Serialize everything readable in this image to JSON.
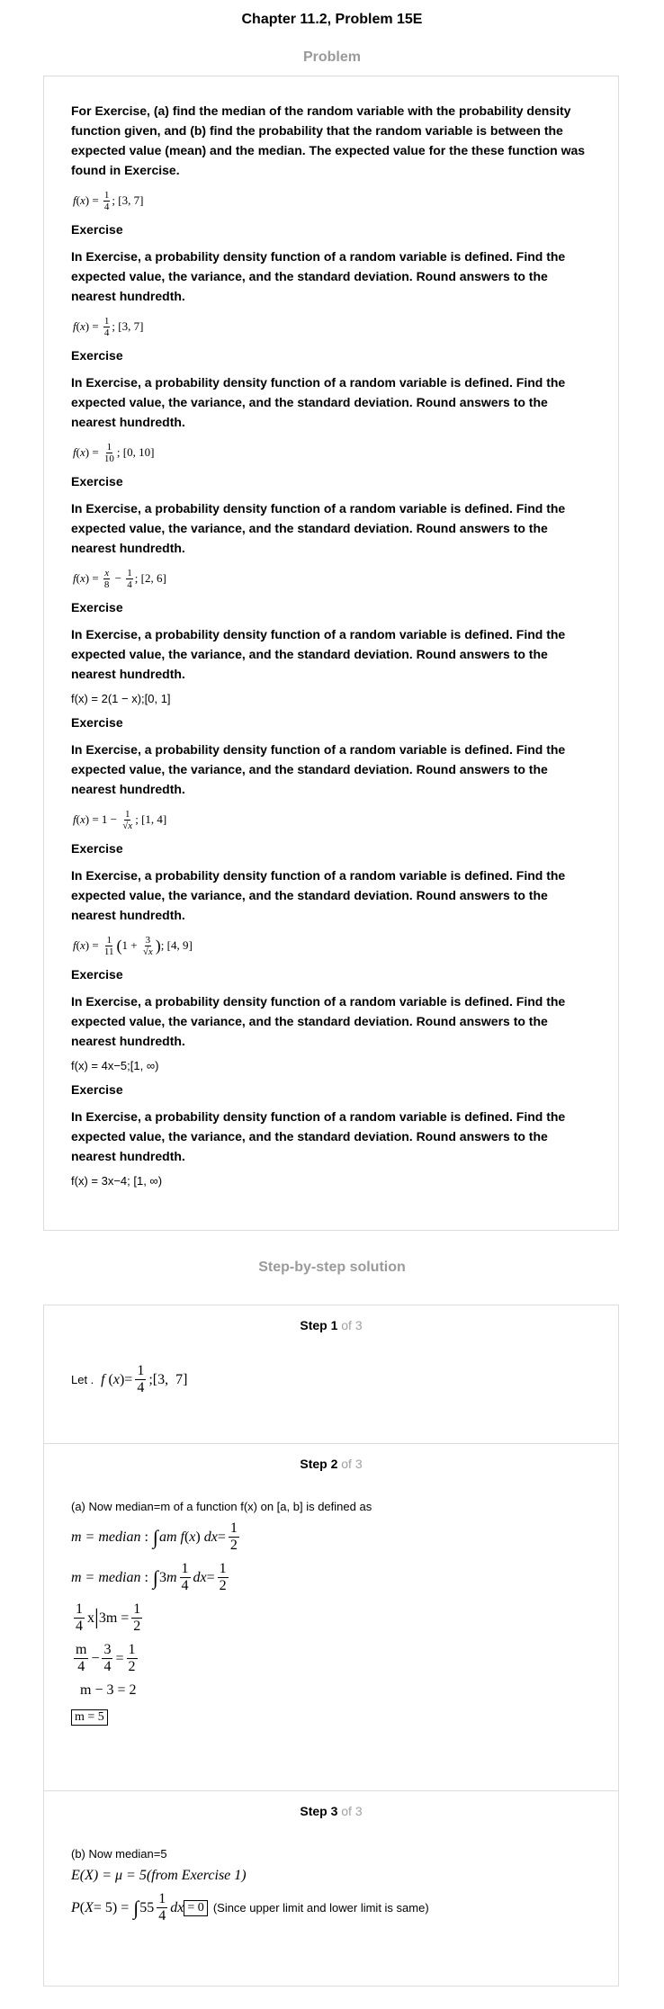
{
  "title": "Chapter 11.2, Problem 15E",
  "problem_heading": "Problem",
  "solution_heading": "Step-by-step solution",
  "intro": "For Exercise, (a) find the median of the random variable with the probability density function given, and (b) find the probability that the random variable is between the expected value (mean) and the median. The expected value for the these function was found in Exercise.",
  "exercise_label": "Exercise",
  "exercise_text": "In Exercise, a probability density function of a random variable is defined. Find the expected value, the variance, and the standard deviation. Round answers to the nearest hundredth.",
  "formulas": {
    "f0_interval": "[3, 7]",
    "f1_interval": "[3, 7]",
    "f2_interval": "[0, 10]",
    "f3_interval": "[2, 6]",
    "f4_text": "f(x) = 2(1 − x);[0, 1]",
    "f5_interval": "[1, 4]",
    "f6_interval": "[4, 9]",
    "f7_text": "f(x) = 4x−5;[1, ∞)",
    "f8_text": "f(x) = 3x−4; [1, ∞)"
  },
  "steps": [
    {
      "label": "Step 1",
      "of": "of 3"
    },
    {
      "label": "Step 2",
      "of": "of 3"
    },
    {
      "label": "Step 3",
      "of": "of 3"
    }
  ],
  "step1": {
    "let": "Let ."
  },
  "step2": {
    "intro": "(a) Now median=m of a function f(x) on [a, b] is defined as",
    "result": "m = 5"
  },
  "step3": {
    "intro": "(b) Now median=5",
    "note": "(Since upper limit and lower limit is same)",
    "expected": "E(X) = μ = 5(from Exercise 1)"
  }
}
